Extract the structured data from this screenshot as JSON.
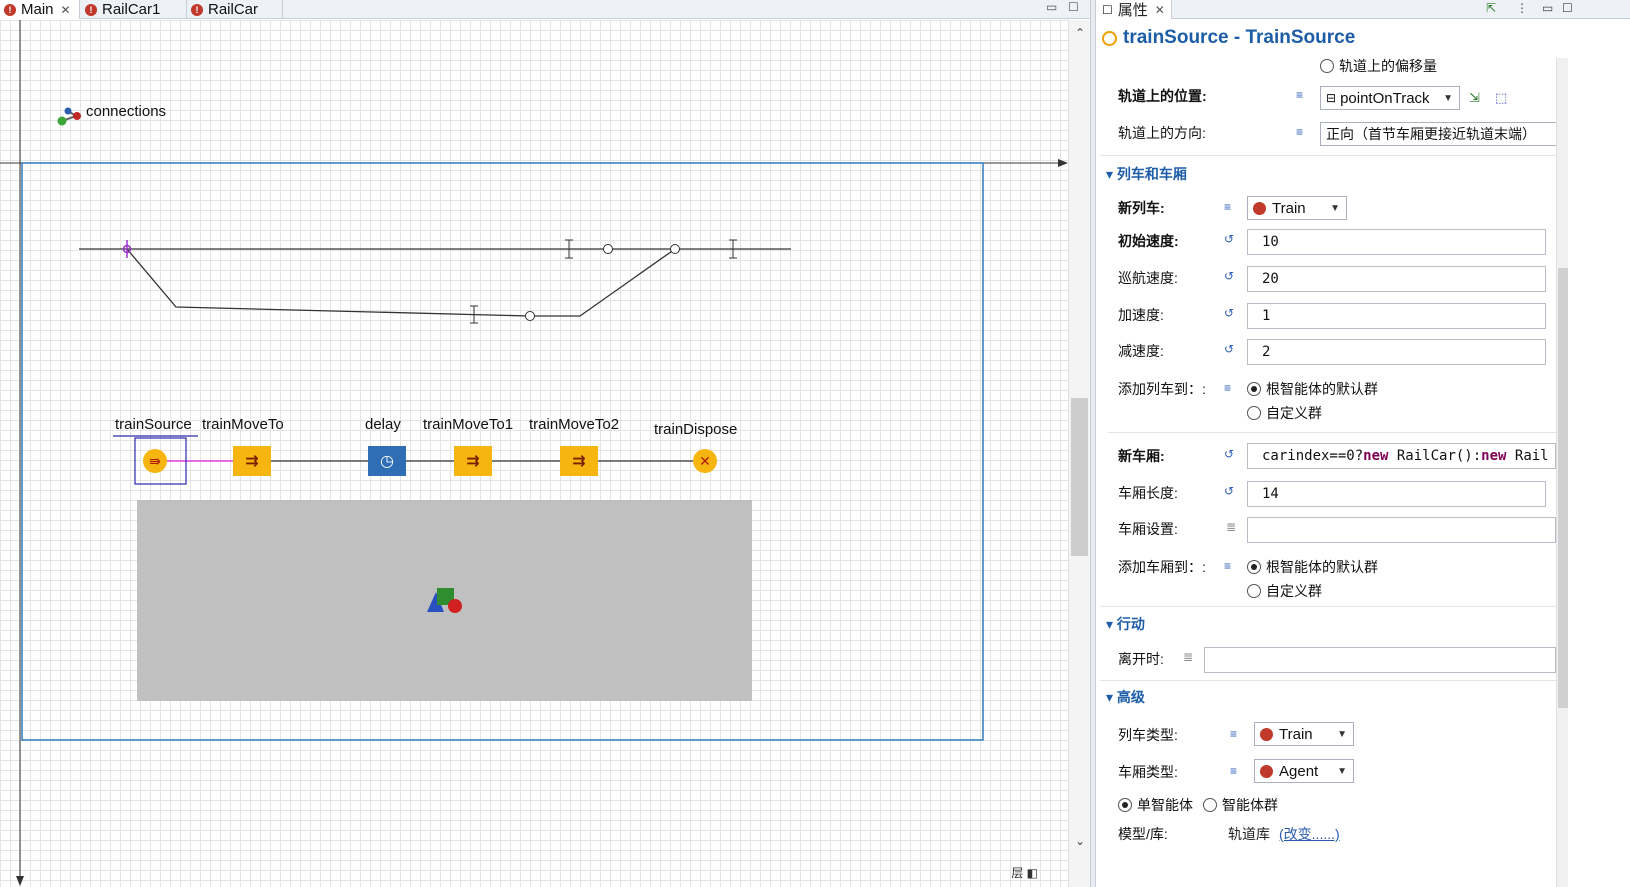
{
  "editor": {
    "tabs": [
      {
        "label": "Main"
      },
      {
        "label": "RailCar1"
      },
      {
        "label": "RailCar"
      }
    ],
    "connections_label": "connections",
    "blocks": {
      "source": "trainSource",
      "move1": "trainMoveTo",
      "delay": "delay",
      "move2": "trainMoveTo1",
      "move3": "trainMoveTo2",
      "dispose": "trainDispose"
    }
  },
  "props": {
    "tab_label": "属性",
    "title": "trainSource - TrainSource",
    "offset_radio": "轨道上的偏移量",
    "position_label": "轨道上的位置:",
    "position_value": "pointOnTrack",
    "direction_label": "轨道上的方向:",
    "direction_value": "正向（首节车厢更接近轨道末端）",
    "section_train": "列车和车厢",
    "new_train_label": "新列车:",
    "new_train_value": "Train",
    "init_speed_label": "初始速度:",
    "init_speed_value": "10",
    "cruise_speed_label": "巡航速度:",
    "cruise_speed_value": "20",
    "accel_label": "加速度:",
    "accel_value": "1",
    "decel_label": "减速度:",
    "decel_value": "2",
    "add_train_label": "添加列车到：:",
    "radio_default_pop": "根智能体的默认群",
    "radio_custom_pop": "自定义群",
    "new_car_label": "新车厢:",
    "new_car_code_a": "carindex==0?",
    "new_car_kw1": "new",
    "new_car_code_b": " RailCar():",
    "new_car_kw2": "new",
    "new_car_code_c": " Rail",
    "car_length_label": "车厢长度:",
    "car_length_value": "14",
    "car_setup_label": "车厢设置:",
    "add_car_label": "添加车厢到：:",
    "radio_default_pop2": "根智能体的默认群",
    "radio_custom_pop2": "自定义群",
    "section_action": "行动",
    "on_exit_label": "离开时:",
    "section_advanced": "高级",
    "train_type_label": "列车类型:",
    "train_type_value": "Train",
    "car_type_label": "车厢类型:",
    "car_type_value": "Agent",
    "radio_single": "单智能体",
    "radio_population": "智能体群",
    "model_lib_label": "模型/库:",
    "model_lib_value": "轨道库",
    "model_lib_link": "(改变......)"
  },
  "colors": {
    "accent": "#1d5da8",
    "block_orange": "#f7b512",
    "delay_blue": "#2f6db5",
    "frame_blue": "#2e7bbf",
    "presentation_gray": "#c0c0c0"
  }
}
